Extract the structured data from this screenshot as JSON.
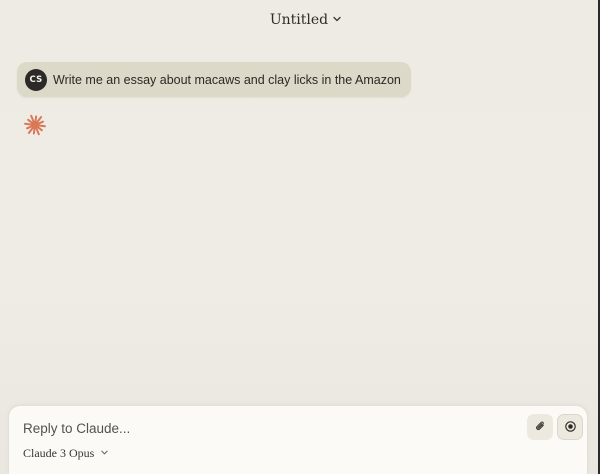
{
  "header": {
    "title": "Untitled",
    "title_dropdown_icon": "chevron-down-icon"
  },
  "conversation": {
    "user_message": {
      "avatar_initials": "CS",
      "text": "Write me an essay about macaws and clay licks in the Amazon"
    },
    "assistant": {
      "logo_icon": "claude-sparkle-icon",
      "logo_color": "#D97757"
    }
  },
  "composer": {
    "placeholder": "Reply to Claude...",
    "value": "",
    "attach_icon": "paperclip-icon",
    "voice_icon": "record-icon",
    "model_label": "Claude 3 Opus",
    "model_dropdown_icon": "chevron-down-icon"
  },
  "colors": {
    "background": "#EDEBE3",
    "user_bubble": "#DDD9C8",
    "avatar": "#2C2A26",
    "accent": "#D97757"
  }
}
